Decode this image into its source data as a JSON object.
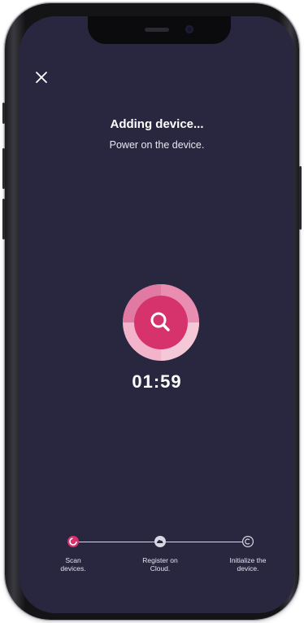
{
  "screen": {
    "title": "Adding device...",
    "subtitle": "Power on the device.",
    "timer": "01:59",
    "close_icon": "close-icon",
    "scan_icon": "search-icon"
  },
  "steps": [
    {
      "label": "Scan\ndevices.",
      "state": "active",
      "icon": "loading-ring-icon"
    },
    {
      "label": "Register on\nCloud.",
      "state": "pending",
      "icon": "cloud-icon"
    },
    {
      "label": "Initialize the\ndevice.",
      "state": "pending",
      "icon": "initialize-icon"
    }
  ],
  "colors": {
    "background": "#29273f",
    "accent": "#d6336c",
    "accent_light": "#f2b4cb",
    "text": "#ffffff"
  }
}
